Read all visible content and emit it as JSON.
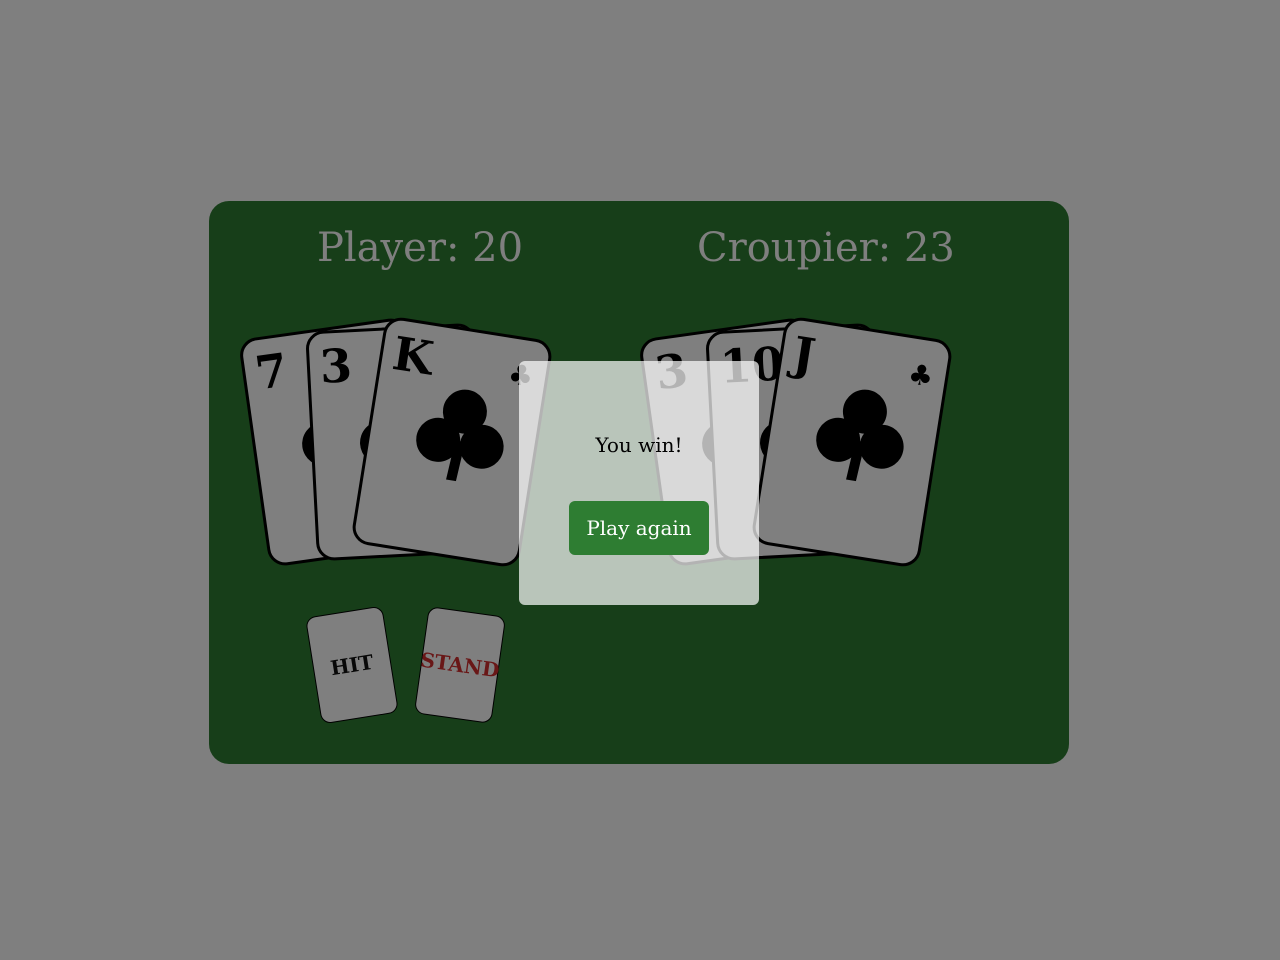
{
  "colors": {
    "table": "#2e7d32",
    "card_face": "#ffffff",
    "stand_text": "#d32f2f",
    "button_bg": "#2e7d32",
    "page_bg": "#ffffff"
  },
  "player": {
    "score_label": "Player: 20",
    "cards": [
      {
        "rank": "7",
        "suit_icon": "club-icon"
      },
      {
        "rank": "3",
        "suit_icon": "club-icon"
      },
      {
        "rank": "K",
        "suit_icon": "club-icon"
      }
    ]
  },
  "croupier": {
    "score_label": "Croupier: 23",
    "cards": [
      {
        "rank": "3",
        "suit_icon": "club-icon"
      },
      {
        "rank": "10",
        "suit_icon": "club-icon"
      },
      {
        "rank": "J",
        "suit_icon": "club-icon"
      }
    ]
  },
  "actions": {
    "hit_label": "HIT",
    "stand_label": "STAND"
  },
  "modal": {
    "message": "You win!",
    "button_label": "Play again"
  }
}
